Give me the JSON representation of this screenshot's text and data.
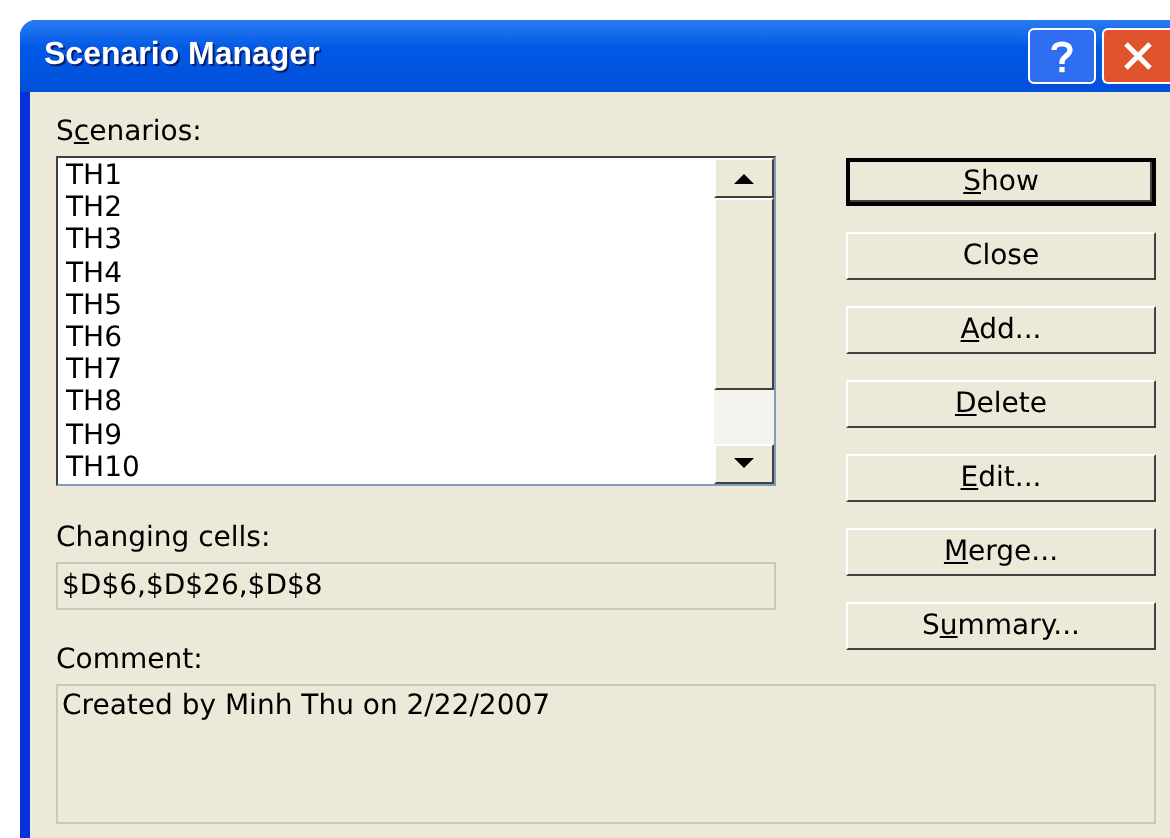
{
  "window": {
    "title": "Scenario Manager"
  },
  "scenarios": {
    "label": {
      "pre": "S",
      "key": "c",
      "post": "enarios:"
    },
    "items": [
      {
        "name": "TH1",
        "selected": false
      },
      {
        "name": "TH2",
        "selected": false
      },
      {
        "name": "TH3",
        "selected": false
      },
      {
        "name": "TH4",
        "selected": false
      },
      {
        "name": "TH5",
        "selected": false
      },
      {
        "name": "TH6",
        "selected": false
      },
      {
        "name": "TH7",
        "selected": false
      },
      {
        "name": "TH8",
        "selected": false
      },
      {
        "name": "TH9",
        "selected": false
      },
      {
        "name": "TH10",
        "selected": false
      }
    ]
  },
  "buttons": [
    {
      "key": "S",
      "post": "how",
      "default": true
    },
    {
      "pre": "Close",
      "default": false
    },
    {
      "key": "A",
      "post": "dd...",
      "default": false
    },
    {
      "key": "D",
      "post": "elete",
      "default": false
    },
    {
      "key": "E",
      "post": "dit...",
      "default": false
    },
    {
      "key": "M",
      "post": "erge...",
      "default": false
    },
    {
      "pre": "S",
      "key": "u",
      "post": "mmary...",
      "default": false
    }
  ],
  "changing_cells": {
    "label": "Changing cells:",
    "value": "$D$6,$D$26,$D$8"
  },
  "comment": {
    "label": "Comment:",
    "value": "Created by Minh Thu on 2/22/2007"
  }
}
